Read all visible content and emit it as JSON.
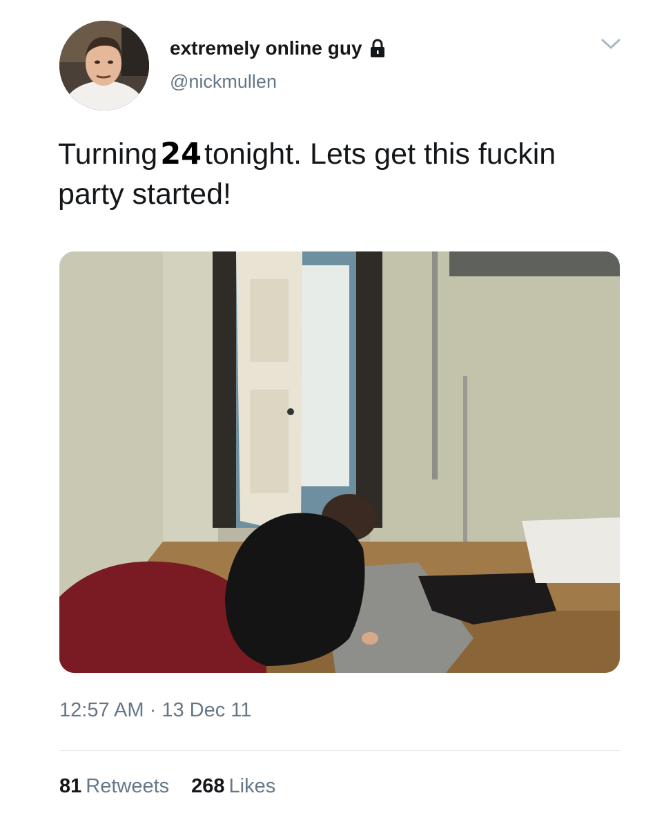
{
  "user": {
    "display_name": "extremely online guy",
    "handle": "@nickmullen",
    "protected_icon": "lock-icon",
    "menu_icon": "chevron-down-icon"
  },
  "tweet": {
    "text_before": "Turning",
    "text_number": "24",
    "text_after": "tonight. Lets get this fuckin party started!",
    "time": "12:57 AM",
    "separator": "·",
    "date": "13 Dec 11"
  },
  "stats": {
    "retweets_count": "81",
    "retweets_label": "Retweets",
    "likes_count": "268",
    "likes_label": "Likes"
  },
  "colors": {
    "text_primary": "#14171a",
    "text_secondary": "#657786",
    "divider": "#e1e8ed"
  }
}
